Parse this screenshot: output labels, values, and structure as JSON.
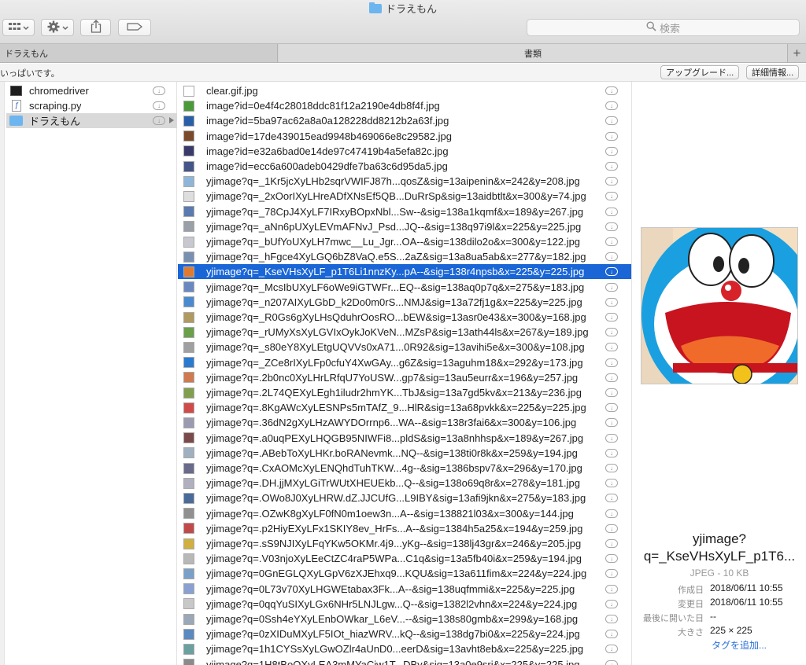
{
  "window": {
    "title": "ドラえもん"
  },
  "toolbar": {
    "search_placeholder": "検索"
  },
  "tabs": [
    {
      "label": "ドラえもん"
    },
    {
      "label": "書類"
    }
  ],
  "infobar": {
    "text": "いっぱいです。",
    "upgrade_label": "アップグレード...",
    "details_label": "詳細情報..."
  },
  "column1": [
    {
      "name": "chromedriver",
      "icon": "terminal-exec-icon"
    },
    {
      "name": "scraping.py",
      "icon": "python-file-icon"
    },
    {
      "name": "ドラえもん",
      "icon": "folder-icon",
      "selected": true
    }
  ],
  "files": [
    "clear.gif.jpg",
    "image?id=0e4f4c28018ddc81f12a2190e4db8f4f.jpg",
    "image?id=5ba97ac62a8a0a128228dd8212b2a63f.jpg",
    "image?id=17de439015ead9948b469066e8c29582.jpg",
    "image?id=e32a6bad0e14de97c47419b4a5efa82c.jpg",
    "image?id=ecc6a600adeb0429dfe7ba63c6d95da5.jpg",
    "yjimage?q=_1Kr5jcXyLHb2sqrVWIFJ87h...qosZ&sig=13aipenin&x=242&y=208.jpg",
    "yjimage?q=_2xOorIXyLHreADfXNsEf5QB...DuRrSp&sig=13aidbtlt&x=300&y=74.jpg",
    "yjimage?q=_78CpJ4XyLF7IRxyBOpxNbl...Sw--&sig=138a1kqmf&x=189&y=267.jpg",
    "yjimage?q=_aNn6pUXyLEVmAFNvJ_Psd...JQ--&sig=138q97i9l&x=225&y=225.jpg",
    "yjimage?q=_bUfYoUXyLH7mwc__Lu_Jgr...OA--&sig=138dilo2o&x=300&y=122.jpg",
    "yjimage?q=_hFgce4XyLGQ6bZ8VaQ.e5S...2aZ&sig=13a8ua5ab&x=277&y=182.jpg",
    "yjimage?q=_KseVHsXyLF_p1T6Li1nnzKy...pA--&sig=138r4npsb&x=225&y=225.jpg",
    "yjimage?q=_McsIbUXyLF6oWe9iGTWFr...EQ--&sig=138aq0p7q&x=275&y=183.jpg",
    "yjimage?q=_n207AIXyLGbD_k2Do0m0rS...NMJ&sig=13a72fj1g&x=225&y=225.jpg",
    "yjimage?q=_R0Gs6gXyLHsQduhrOosRO...bEW&sig=13asr0e43&x=300&y=168.jpg",
    "yjimage?q=_rUMyXsXyLGVIxOykJoKVeN...MZsP&sig=13ath44ls&x=267&y=189.jpg",
    "yjimage?q=_s80eY8XyLEtgUQVVs0xA71...0R92&sig=13avihi5e&x=300&y=108.jpg",
    "yjimage?q=_ZCe8rIXyLFp0cfuY4XwGAy...g6Z&sig=13aguhm18&x=292&y=173.jpg",
    "yjimage?q=.2b0nc0XyLHrLRfqU7YoUSW...gp7&sig=13au5eurr&x=196&y=257.jpg",
    "yjimage?q=.2L74QEXyLEgh1iludr2hmYK...TbJ&sig=13a7gd5kv&x=213&y=236.jpg",
    "yjimage?q=.8KgAWcXyLESNPs5mTAfZ_9...HlR&sig=13a68pvkk&x=225&y=225.jpg",
    "yjimage?q=.36dN2gXyLHzAWYDOrrnp6...WA--&sig=138r3fai6&x=300&y=106.jpg",
    "yjimage?q=.a0uqPEXyLHQGB95NIWFi8...pldS&sig=13a8nhhsp&x=189&y=267.jpg",
    "yjimage?q=.ABebToXyLHKr.boRANevmk...NQ--&sig=138ti0r8k&x=259&y=194.jpg",
    "yjimage?q=.CxAOMcXyLENQhdTuhTKW...4g--&sig=1386bspv7&x=296&y=170.jpg",
    "yjimage?q=.DH.jjMXyLGiTrWUtXHEUEkb...Q--&sig=138o69q8r&x=278&y=181.jpg",
    "yjimage?q=.OWo8J0XyLHRW.dZ.JJCUfG...L9IBY&sig=13afi9jkn&x=275&y=183.jpg",
    "yjimage?q=.OZwK8gXyLF0fN0m1oew3n...A--&sig=138821l03&x=300&y=144.jpg",
    "yjimage?q=.p2HiyEXyLFx1SKIY8ev_HrFs...A--&sig=1384h5a25&x=194&y=259.jpg",
    "yjimage?q=.sS9NJIXyLFqYKw5OKMr.4j9...yKg--&sig=138lj43gr&x=246&y=205.jpg",
    "yjimage?q=.V03njoXyLEeCtZC4raP5WPa...C1q&sig=13a5fb40i&x=259&y=194.jpg",
    "yjimage?q=0GnEGLQXyLGpV6zXJEhxq9...KQU&sig=13a611fim&x=224&y=224.jpg",
    "yjimage?q=0L73v70XyLHGWEtabax3Fk...A--&sig=138uqfmmi&x=225&y=225.jpg",
    "yjimage?q=0qqYuSIXyLGx6NHr5LNJLgw...Q--&sig=1382l2vhn&x=224&y=224.jpg",
    "yjimage?q=0Ssh4eYXyLEnbOWkar_L6eV...--&sig=138s80gmb&x=299&y=168.jpg",
    "yjimage?q=0zXIDuMXyLF5IOt_hiazWRV...kQ--&sig=138dg7bi0&x=225&y=224.jpg",
    "yjimage?q=1h1CYSsXyLGwOZlr4aUnD0...eerD&sig=13avht8eb&x=225&y=225.jpg",
    "yjimage?q=1H8tBoOXyLEA3mMYaCiw1T...DBy&sig=13a0e9sri&x=225&y=225.jpg"
  ],
  "selected_file_index": 12,
  "preview": {
    "title_line1": "yjimage?",
    "title_line2": "q=_KseVHsXyLF_p1T6...",
    "kind": "JPEG - 10 KB",
    "created_label": "作成日",
    "created_value": "2018/06/11 10:55",
    "modified_label": "変更日",
    "modified_value": "2018/06/11 10:55",
    "last_opened_label": "最後に開いた日",
    "last_opened_value": "--",
    "size_label": "大きさ",
    "size_value": "225 × 225",
    "add_tags": "タグを追加..."
  },
  "colors": {
    "selection": "#1a66d6",
    "link": "#2a6fd6",
    "folder": "#6cb5ef"
  }
}
